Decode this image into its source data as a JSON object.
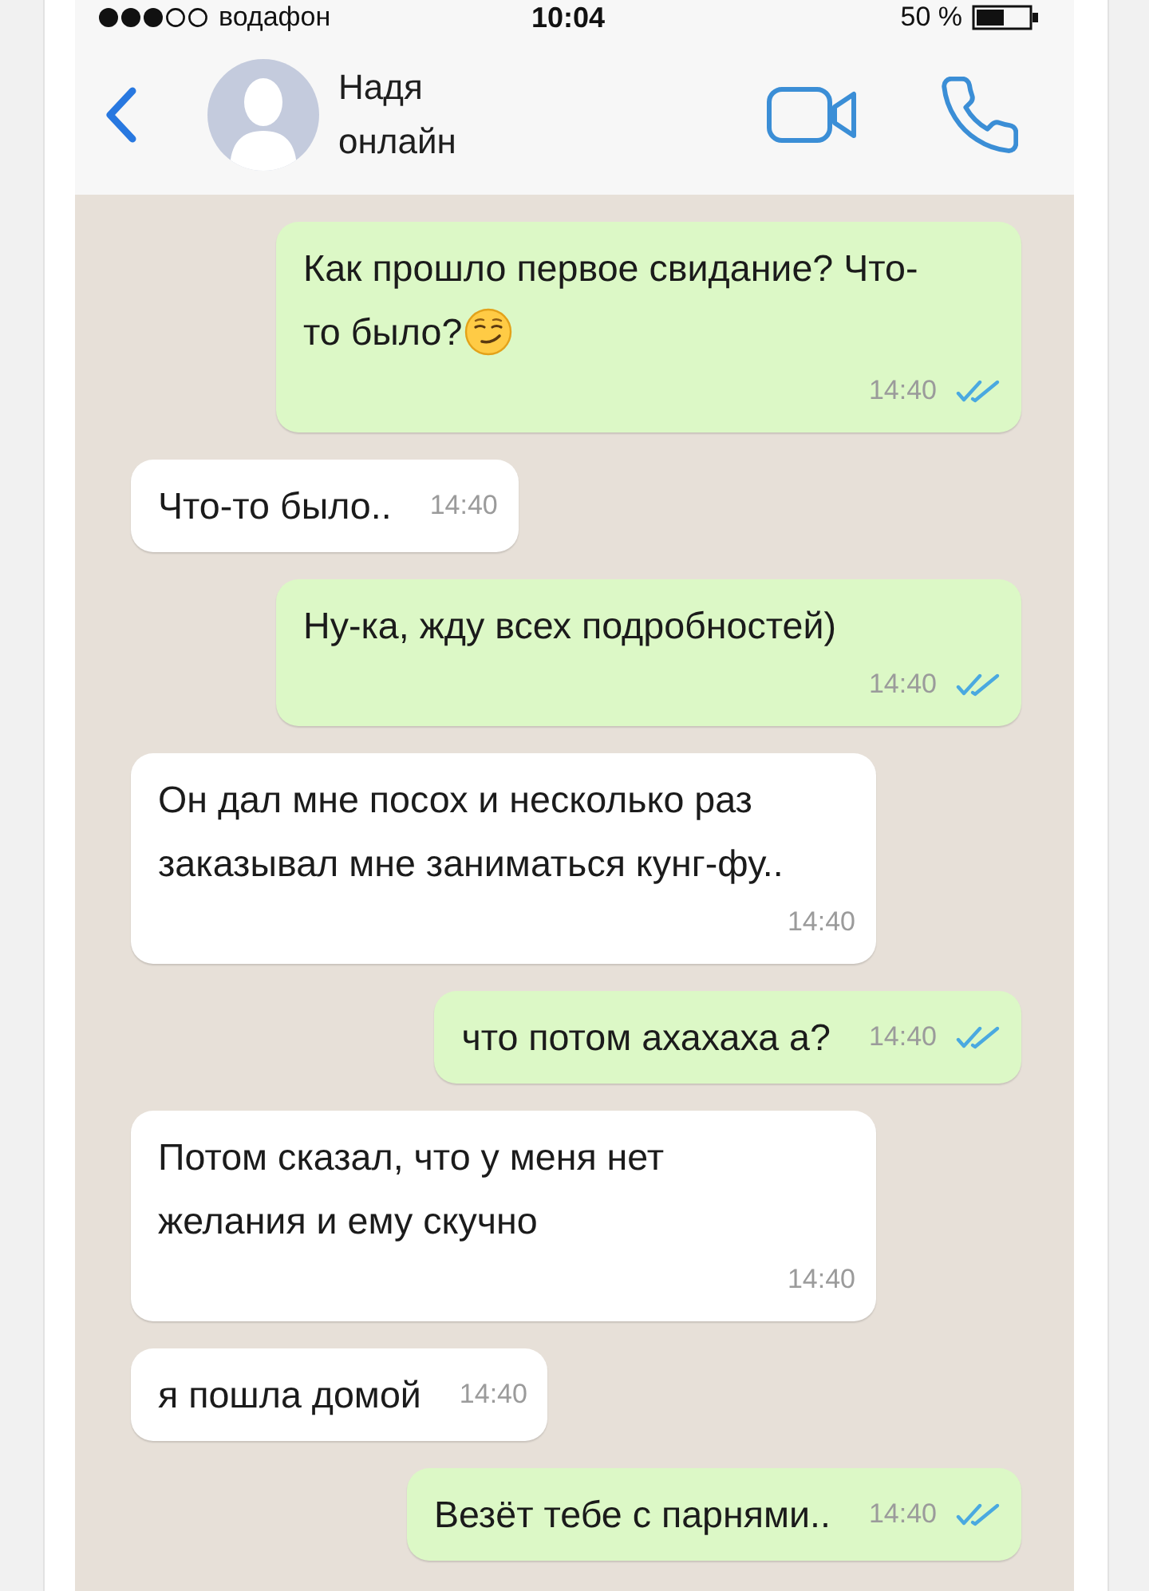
{
  "status_bar": {
    "carrier": "водафон",
    "time": "10:04",
    "battery": "50 %"
  },
  "header": {
    "name": "Надя",
    "status": "онлайн"
  },
  "messages": [
    {
      "kind": "outgoing",
      "text": "Как прошло первое свидание? Что-то было?",
      "emoji": true,
      "time": "14:40",
      "read": true
    },
    {
      "kind": "incoming",
      "text": "Что-то было..",
      "emoji": false,
      "time": "14:40"
    },
    {
      "kind": "outgoing",
      "text": "Ну-ка, жду всех подробностей)",
      "emoji": false,
      "time": "14:40",
      "read": true
    },
    {
      "kind": "incoming",
      "text": "Он дал мне посох и несколько раз заказывал мне заниматься кунг-фу..",
      "emoji": false,
      "time": "14:40"
    },
    {
      "kind": "outgoing",
      "text": "что потом ахахаха а?",
      "emoji": false,
      "time": "14:40",
      "read": true
    },
    {
      "kind": "incoming",
      "text": "Потом сказал, что у меня нет желания и ему скучно",
      "emoji": false,
      "time": "14:40"
    },
    {
      "kind": "incoming",
      "text": "я пошла домой",
      "emoji": false,
      "time": "14:40"
    },
    {
      "kind": "outgoing",
      "text": "Везёт тебе с парнями..",
      "emoji": false,
      "time": "14:40",
      "read": true
    }
  ]
}
